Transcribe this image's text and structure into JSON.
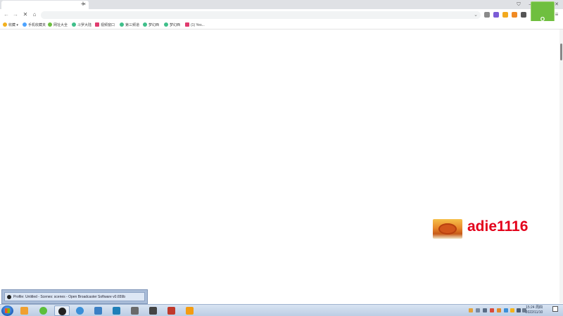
{
  "browser": {
    "new_tab_symbol": "+",
    "tab_close_symbol": "×",
    "window_buttons": [
      "⛉",
      "—",
      "☐",
      "✕"
    ],
    "nav": {
      "back": "←",
      "forward": "→",
      "stop": "✕",
      "home": "⌂"
    },
    "address_value": "",
    "dropdown_symbol": "⌄",
    "profile_label": "Q",
    "menu_symbol": "≡"
  },
  "bookmarks": [
    {
      "label": "收藏",
      "icon": "star-icon",
      "color": "#f2b01e"
    },
    {
      "label": "手机收藏夹",
      "icon": "phone-icon",
      "color": "#4da3ff"
    },
    {
      "label": "网址大全",
      "icon": "globe-icon",
      "color": "#6cbf3f"
    },
    {
      "label": "斗罗大陆",
      "icon": "site-icon",
      "color": "#3fbf8a"
    },
    {
      "label": "视频窗口",
      "icon": "video-icon",
      "color": "#e03b6e"
    },
    {
      "label": "第三频道",
      "icon": "site-icon",
      "color": "#3fbf8a"
    },
    {
      "label": "梦幻西",
      "icon": "site-icon",
      "color": "#3fbf8a"
    },
    {
      "label": "梦幻西",
      "icon": "site-icon",
      "color": "#3fbf8a"
    },
    {
      "label": "(1) Yes...",
      "icon": "video-icon",
      "color": "#e03b6e"
    }
  ],
  "watermark": {
    "text": "adie1116"
  },
  "obs_popup": {
    "title": "Profile: Untitled - Scenes: scenes - Open Broadcaster Software v0.659b"
  },
  "taskbar": {
    "apps": [
      {
        "name": "qq-icon",
        "color": "#f0a030"
      },
      {
        "name": "browser-icon",
        "color": "#5bbf3a"
      },
      {
        "name": "obs-icon",
        "color": "#222222",
        "active": true
      },
      {
        "name": "edge-icon",
        "color": "#3a8fd8"
      },
      {
        "name": "vscode-icon",
        "color": "#3b7fc4"
      },
      {
        "name": "app-icon",
        "color": "#1e7fb8"
      },
      {
        "name": "android-icon",
        "color": "#6a6a6a"
      },
      {
        "name": "owl-icon",
        "color": "#444444"
      },
      {
        "name": "game-icon",
        "color": "#c0392b"
      },
      {
        "name": "player-icon",
        "color": "#f39c12"
      }
    ],
    "tray": [
      "#e2a23b",
      "#7a8aa0",
      "#5a6d86",
      "#d94b3a",
      "#e08a2a",
      "#3b8fd8",
      "#f4b31a",
      "#4a5b72",
      "#6d7c90"
    ],
    "time": "15:24 周四",
    "date": "2022/11/10"
  }
}
